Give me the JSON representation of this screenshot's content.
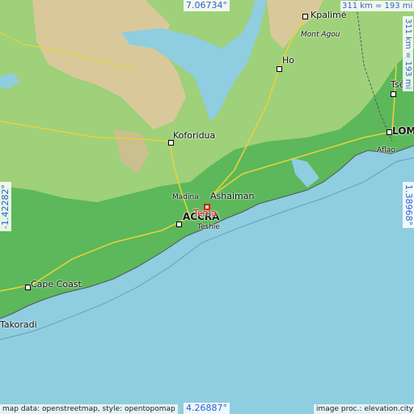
{
  "map": {
    "highlighted_place": "Tema",
    "places": {
      "kpalime": "Kpalimé",
      "mont_agou": "Mont Agou",
      "ho": "Ho",
      "tsevie": "Tsév",
      "lome": "LOM",
      "aflao": "Aflao",
      "koforidua": "Koforidua",
      "madina": "Madina",
      "ashaiman": "Ashaiman",
      "accra": "ACCRA",
      "tema": "Tema",
      "teshie": "Teshie",
      "cape_coast": "Cape Coast",
      "takoradi": "Takoradi"
    },
    "coordinates": {
      "top": "7.06734°",
      "bottom": "4.26887°",
      "left": "-1.42282°",
      "right": "1.38968°"
    },
    "scale": {
      "horizontal": "311 km = 193 mi",
      "vertical": "311 km = 193 mi"
    },
    "credits": {
      "left": "map data: openstreetmap, style: opentopomap",
      "right": "image proc.: elevation.city"
    },
    "colors": {
      "sea": "#8fcde0",
      "lowland": "#5cb85a",
      "upland": "#9fd07a",
      "highland": "#d9c99a",
      "coordinate_text": "#2d5fd6",
      "highlight": "#d81b1b"
    }
  }
}
